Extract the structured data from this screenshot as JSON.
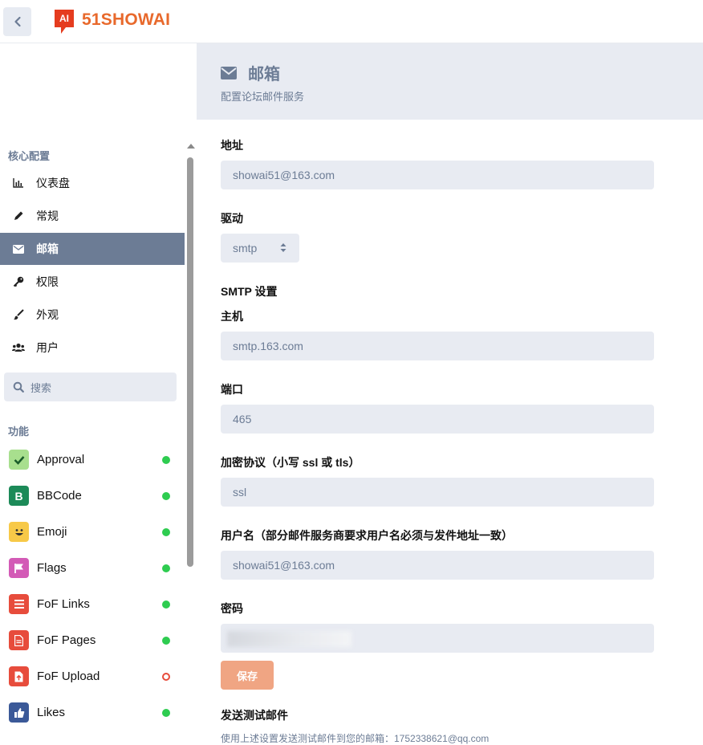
{
  "header": {
    "logo_text": "51SHOWAI",
    "logo_badge": "AI",
    "brand_color": "#e8692c"
  },
  "hero": {
    "title": "邮箱",
    "subtitle": "配置论坛邮件服务",
    "bg_color": "#e8ebf2"
  },
  "sidebar": {
    "core_label": "核心配置",
    "items": [
      {
        "label": "仪表盘",
        "icon": "chart-icon"
      },
      {
        "label": "常规",
        "icon": "pencil-icon"
      },
      {
        "label": "邮箱",
        "icon": "envelope-icon",
        "active": true
      },
      {
        "label": "权限",
        "icon": "key-icon"
      },
      {
        "label": "外观",
        "icon": "paintbrush-icon"
      },
      {
        "label": "用户",
        "icon": "users-icon"
      }
    ],
    "search_placeholder": "搜索",
    "features_label": "功能",
    "extensions": [
      {
        "name": "Approval",
        "icon": "check-icon",
        "color": "#a8df8e",
        "enabled": true
      },
      {
        "name": "BBCode",
        "icon": "bold-icon",
        "color": "#1c8a58",
        "enabled": true
      },
      {
        "name": "Emoji",
        "icon": "smile-icon",
        "color": "#f7c948",
        "enabled": true
      },
      {
        "name": "Flags",
        "icon": "flag-icon",
        "color": "#d35ab6",
        "enabled": true
      },
      {
        "name": "FoF Links",
        "icon": "list-icon",
        "color": "#e74c3c",
        "enabled": true
      },
      {
        "name": "FoF Pages",
        "icon": "file-icon",
        "color": "#e74c3c",
        "enabled": true
      },
      {
        "name": "FoF Upload",
        "icon": "upload-icon",
        "color": "#e74c3c",
        "enabled": false
      },
      {
        "name": "Likes",
        "icon": "thumbs-up-icon",
        "color": "#3b5998",
        "enabled": true
      }
    ]
  },
  "form": {
    "address_label": "地址",
    "address_value": "showai51@163.com",
    "driver_label": "驱动",
    "driver_value": "smtp",
    "smtp_section": "SMTP 设置",
    "host_label": "主机",
    "host_value": "smtp.163.com",
    "port_label": "端口",
    "port_value": "465",
    "encryption_label": "加密协议（小写 ssl 或 tls）",
    "encryption_value": "ssl",
    "username_label": "用户名（部分邮件服务商要求用户名必须与发件地址一致）",
    "username_value": "showai51@163.com",
    "password_label": "密码",
    "save_label": "保存",
    "test_title": "发送测试邮件",
    "test_hint": "使用上述设置发送测试邮件到您的邮箱：1752338621@qq.com"
  }
}
